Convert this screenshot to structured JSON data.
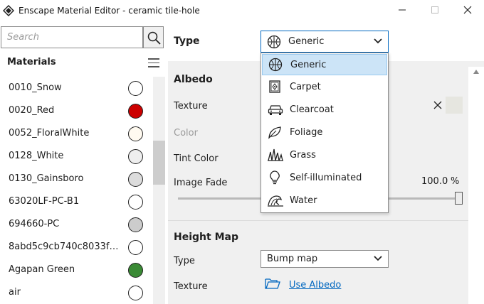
{
  "window": {
    "title": "Enscape Material Editor - ceramic tile-hole"
  },
  "search": {
    "placeholder": "Search",
    "value": ""
  },
  "materials": {
    "header": "Materials",
    "items": [
      {
        "name": "0010_Snow",
        "color": "#ffffff"
      },
      {
        "name": "0020_Red",
        "color": "#cc0000"
      },
      {
        "name": "0052_FloralWhite",
        "color": "#fffaf0"
      },
      {
        "name": "0128_White",
        "color": "#eeeeee"
      },
      {
        "name": "0130_Gainsboro",
        "color": "#dcdcdc"
      },
      {
        "name": "63020LF-PC-B1",
        "color": "#ffffff"
      },
      {
        "name": "694660-PC",
        "color": "#cccccc"
      },
      {
        "name": "8abd5c9cb740c8033fd…",
        "color": "#ffffff"
      },
      {
        "name": "Agapan Green",
        "color": "#3a8a35"
      },
      {
        "name": "air",
        "color": "#ffffff"
      }
    ]
  },
  "type": {
    "label": "Type",
    "selected": "Generic"
  },
  "type_options": [
    {
      "label": "Generic",
      "icon": "generic-icon",
      "selected": true
    },
    {
      "label": "Carpet",
      "icon": "carpet-icon",
      "selected": false
    },
    {
      "label": "Clearcoat",
      "icon": "clearcoat-car-icon",
      "selected": false
    },
    {
      "label": "Foliage",
      "icon": "foliage-leaf-icon",
      "selected": false
    },
    {
      "label": "Grass",
      "icon": "grass-icon",
      "selected": false
    },
    {
      "label": "Self-illuminated",
      "icon": "lightbulb-icon",
      "selected": false
    },
    {
      "label": "Water",
      "icon": "water-wave-icon",
      "selected": false
    }
  ],
  "albedo": {
    "title": "Albedo",
    "texture_label": "Texture",
    "color_label": "Color",
    "tint_label": "Tint Color",
    "fade_label": "Image Fade",
    "fade_value": "100.0",
    "fade_unit": "%",
    "fade_fraction": 1.0
  },
  "height_map": {
    "title": "Height Map",
    "type_label": "Type",
    "type_value": "Bump map",
    "texture_label": "Texture",
    "texture_link": "Use Albedo"
  },
  "colors": {
    "accent": "#0067c0",
    "selection": "#cce4f7"
  }
}
